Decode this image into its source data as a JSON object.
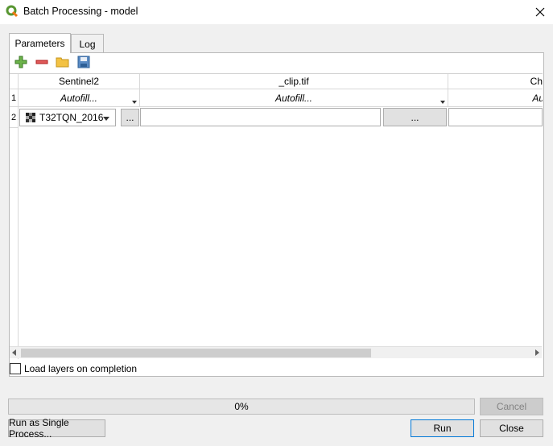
{
  "window": {
    "title": "Batch Processing - model",
    "icon": "qgis-logo-icon",
    "close_icon": "close-icon"
  },
  "tabs": [
    {
      "label": "Parameters",
      "active": true
    },
    {
      "label": "Log",
      "active": false
    }
  ],
  "toolbar": {
    "add": "add-row-icon",
    "remove": "remove-row-icon",
    "open": "open-folder-icon",
    "save": "save-icon"
  },
  "table": {
    "headers": [
      "Sentinel2",
      "_clip.tif",
      "Ch"
    ],
    "rows": [
      {
        "number": "1",
        "autofill": [
          "Autofill...",
          "Autofill...",
          "Au"
        ]
      },
      {
        "number": "2",
        "layer": "T32TQN_2016",
        "browse": "...",
        "output_path": "",
        "browse2": "..."
      }
    ]
  },
  "load_layers": {
    "label": "Load layers on completion",
    "checked": false
  },
  "progress": {
    "value": 0,
    "text": "0%"
  },
  "buttons": {
    "cancel": "Cancel",
    "run_single": "Run as Single Process...",
    "run": "Run",
    "close": "Close"
  },
  "colors": {
    "accent": "#0078d7",
    "progress": "#06b025"
  }
}
